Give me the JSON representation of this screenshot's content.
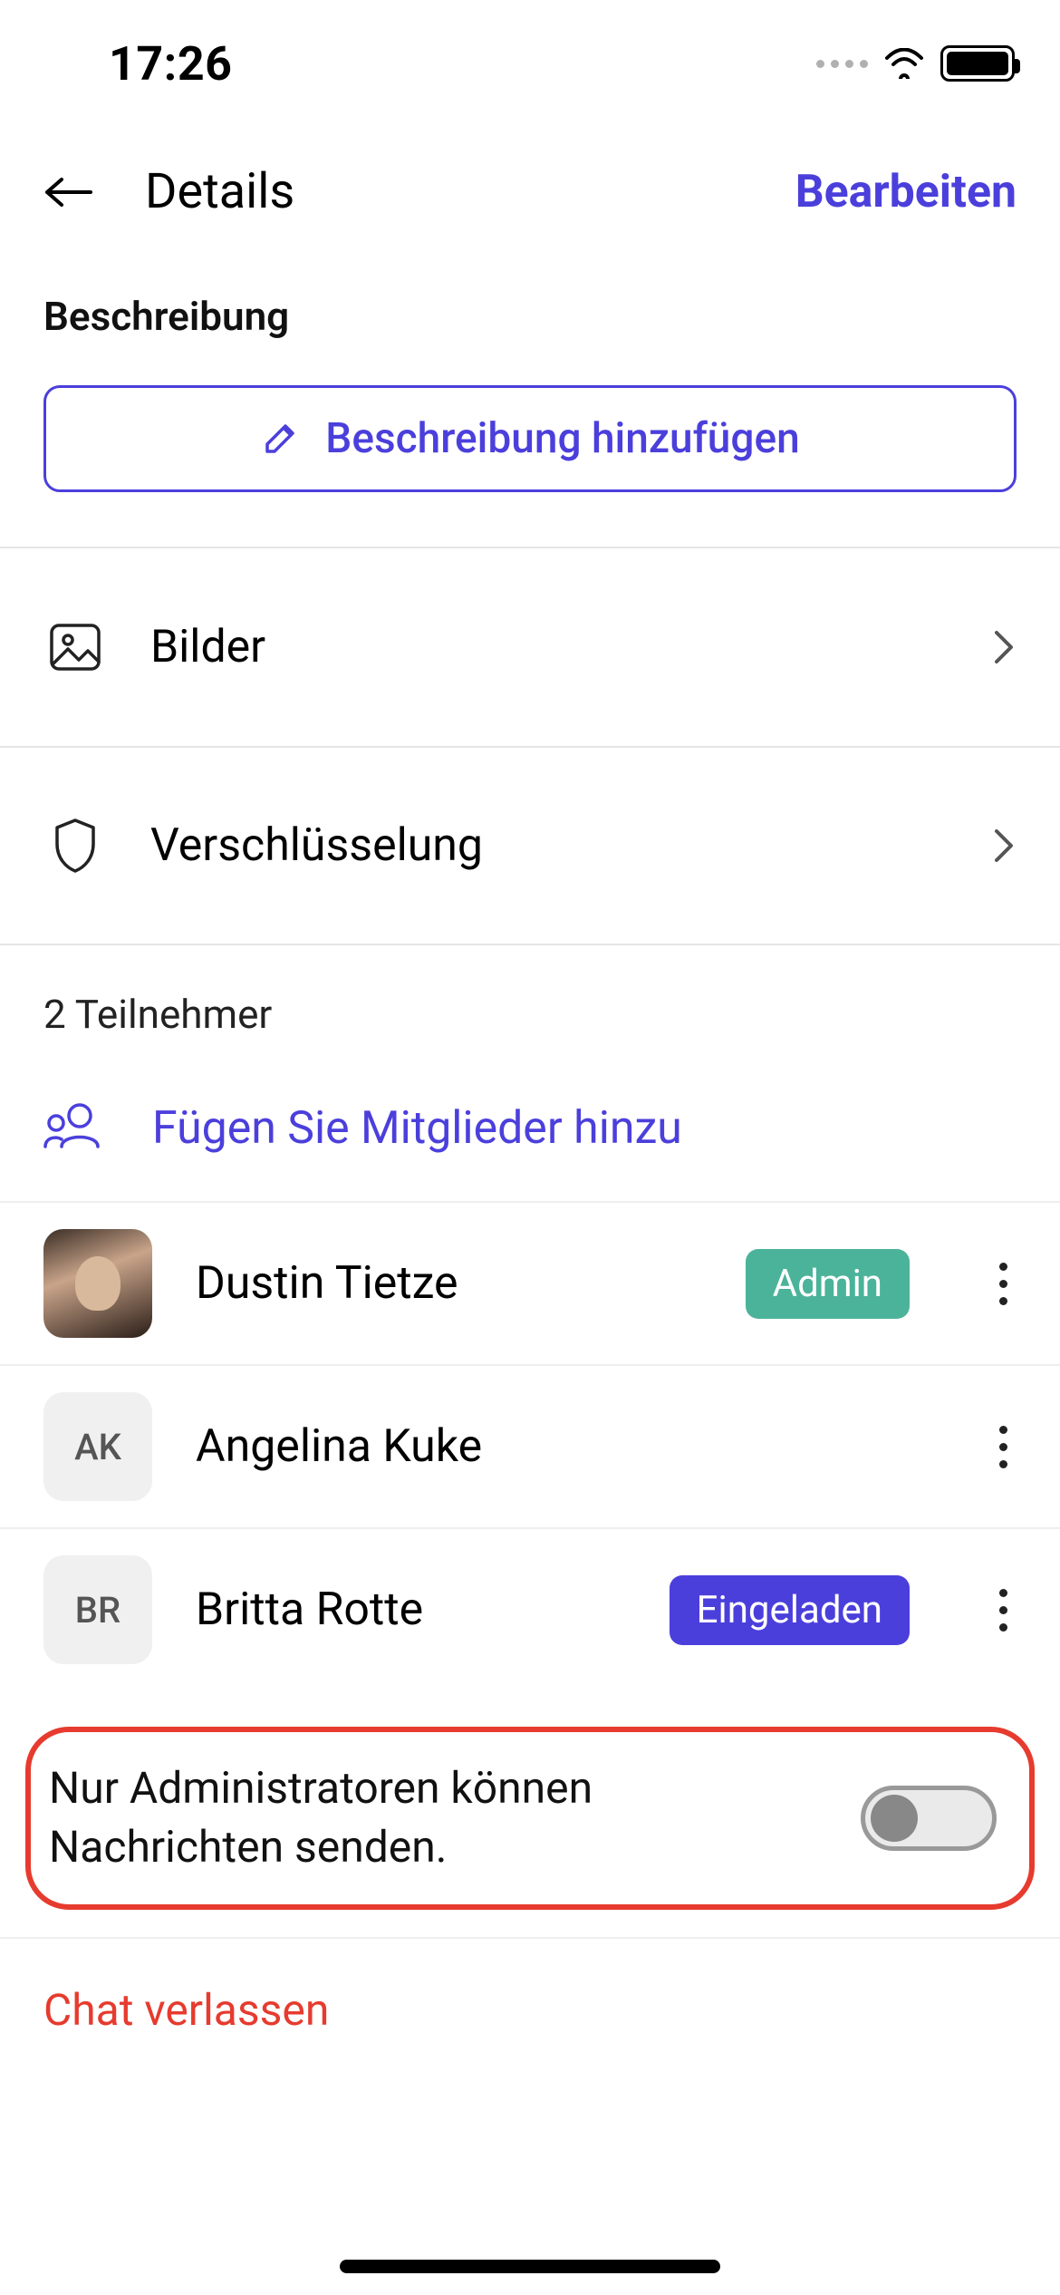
{
  "status": {
    "time": "17:26"
  },
  "nav": {
    "title": "Details",
    "edit": "Bearbeiten"
  },
  "description": {
    "section_label": "Beschreibung",
    "add_button": "Beschreibung hinzufügen"
  },
  "rows": {
    "images": "Bilder",
    "encryption": "Verschlüsselung"
  },
  "participants": {
    "count_label": "2 Teilnehmer",
    "add_label": "Fügen Sie Mitglieder hinzu",
    "members": [
      {
        "name": "Dustin Tietze",
        "initials": "",
        "badge": "Admin",
        "badge_type": "admin",
        "has_photo": true
      },
      {
        "name": "Angelina Kuke",
        "initials": "AK",
        "badge": "",
        "badge_type": "",
        "has_photo": false
      },
      {
        "name": "Britta Rotte",
        "initials": "BR",
        "badge": "Eingeladen",
        "badge_type": "invited",
        "has_photo": false
      }
    ]
  },
  "admin_only": {
    "label": "Nur Administratoren können Nachrichten senden.",
    "enabled": false
  },
  "leave": {
    "label": "Chat verlassen"
  },
  "colors": {
    "accent": "#4b3fdc",
    "danger": "#e63b2e",
    "admin_badge": "#4bb39a"
  }
}
